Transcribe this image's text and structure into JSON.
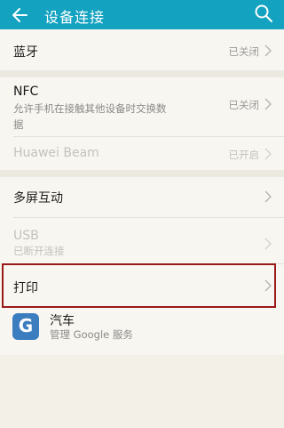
{
  "header": {
    "title": "设备连接",
    "back_icon": "arrow-left-icon",
    "search_icon": "search-icon"
  },
  "items": {
    "bluetooth": {
      "label": "蓝牙",
      "status": "已关闭"
    },
    "nfc": {
      "label": "NFC",
      "description_line1": "允许手机在接触其他设备时交换数",
      "description_line2": "据",
      "status": "已关闭"
    },
    "huawei_beam": {
      "label": "Huawei Beam",
      "status": "已开启"
    },
    "multiscreen": {
      "label": "多屏互动"
    },
    "usb": {
      "label": "USB",
      "description": "已断开连接"
    },
    "print": {
      "label": "打印"
    },
    "car": {
      "label": "汽车",
      "description": "管理 Google 服务",
      "icon_letter": "G"
    }
  },
  "colors": {
    "appbar": "#13a2c0",
    "background": "#f3f0e8",
    "highlight_border": "#9a1a1a"
  }
}
